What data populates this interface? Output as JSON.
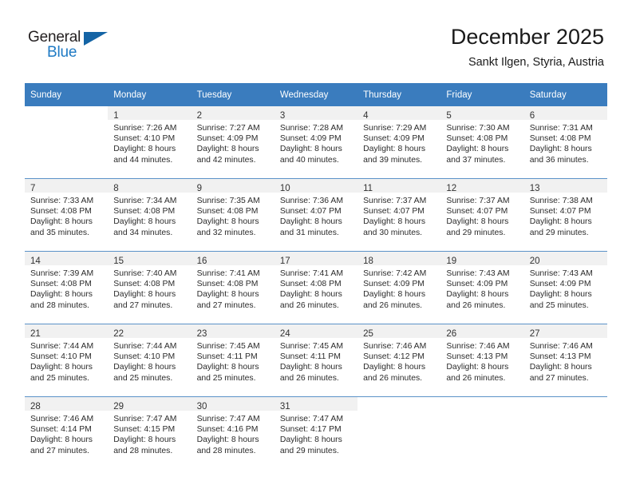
{
  "brand": {
    "name_part1": "General",
    "name_part2": "Blue",
    "triangle_color": "#1464a5",
    "blue_color": "#1e7ac4"
  },
  "header": {
    "title": "December 2025",
    "subtitle": "Sankt Ilgen, Styria, Austria"
  },
  "theme": {
    "header_row_bg": "#3a7cbe",
    "row_divider": "#5b92c8",
    "daynum_band_bg": "#f1f1f1"
  },
  "weekday_headers": [
    "Sunday",
    "Monday",
    "Tuesday",
    "Wednesday",
    "Thursday",
    "Friday",
    "Saturday"
  ],
  "weeks": [
    [
      {
        "day": "",
        "sunrise": "",
        "sunset": "",
        "daylight_line1": "",
        "daylight_line2": ""
      },
      {
        "day": "1",
        "sunrise": "Sunrise: 7:26 AM",
        "sunset": "Sunset: 4:10 PM",
        "daylight_line1": "Daylight: 8 hours",
        "daylight_line2": "and 44 minutes."
      },
      {
        "day": "2",
        "sunrise": "Sunrise: 7:27 AM",
        "sunset": "Sunset: 4:09 PM",
        "daylight_line1": "Daylight: 8 hours",
        "daylight_line2": "and 42 minutes."
      },
      {
        "day": "3",
        "sunrise": "Sunrise: 7:28 AM",
        "sunset": "Sunset: 4:09 PM",
        "daylight_line1": "Daylight: 8 hours",
        "daylight_line2": "and 40 minutes."
      },
      {
        "day": "4",
        "sunrise": "Sunrise: 7:29 AM",
        "sunset": "Sunset: 4:09 PM",
        "daylight_line1": "Daylight: 8 hours",
        "daylight_line2": "and 39 minutes."
      },
      {
        "day": "5",
        "sunrise": "Sunrise: 7:30 AM",
        "sunset": "Sunset: 4:08 PM",
        "daylight_line1": "Daylight: 8 hours",
        "daylight_line2": "and 37 minutes."
      },
      {
        "day": "6",
        "sunrise": "Sunrise: 7:31 AM",
        "sunset": "Sunset: 4:08 PM",
        "daylight_line1": "Daylight: 8 hours",
        "daylight_line2": "and 36 minutes."
      }
    ],
    [
      {
        "day": "7",
        "sunrise": "Sunrise: 7:33 AM",
        "sunset": "Sunset: 4:08 PM",
        "daylight_line1": "Daylight: 8 hours",
        "daylight_line2": "and 35 minutes."
      },
      {
        "day": "8",
        "sunrise": "Sunrise: 7:34 AM",
        "sunset": "Sunset: 4:08 PM",
        "daylight_line1": "Daylight: 8 hours",
        "daylight_line2": "and 34 minutes."
      },
      {
        "day": "9",
        "sunrise": "Sunrise: 7:35 AM",
        "sunset": "Sunset: 4:08 PM",
        "daylight_line1": "Daylight: 8 hours",
        "daylight_line2": "and 32 minutes."
      },
      {
        "day": "10",
        "sunrise": "Sunrise: 7:36 AM",
        "sunset": "Sunset: 4:07 PM",
        "daylight_line1": "Daylight: 8 hours",
        "daylight_line2": "and 31 minutes."
      },
      {
        "day": "11",
        "sunrise": "Sunrise: 7:37 AM",
        "sunset": "Sunset: 4:07 PM",
        "daylight_line1": "Daylight: 8 hours",
        "daylight_line2": "and 30 minutes."
      },
      {
        "day": "12",
        "sunrise": "Sunrise: 7:37 AM",
        "sunset": "Sunset: 4:07 PM",
        "daylight_line1": "Daylight: 8 hours",
        "daylight_line2": "and 29 minutes."
      },
      {
        "day": "13",
        "sunrise": "Sunrise: 7:38 AM",
        "sunset": "Sunset: 4:07 PM",
        "daylight_line1": "Daylight: 8 hours",
        "daylight_line2": "and 29 minutes."
      }
    ],
    [
      {
        "day": "14",
        "sunrise": "Sunrise: 7:39 AM",
        "sunset": "Sunset: 4:08 PM",
        "daylight_line1": "Daylight: 8 hours",
        "daylight_line2": "and 28 minutes."
      },
      {
        "day": "15",
        "sunrise": "Sunrise: 7:40 AM",
        "sunset": "Sunset: 4:08 PM",
        "daylight_line1": "Daylight: 8 hours",
        "daylight_line2": "and 27 minutes."
      },
      {
        "day": "16",
        "sunrise": "Sunrise: 7:41 AM",
        "sunset": "Sunset: 4:08 PM",
        "daylight_line1": "Daylight: 8 hours",
        "daylight_line2": "and 27 minutes."
      },
      {
        "day": "17",
        "sunrise": "Sunrise: 7:41 AM",
        "sunset": "Sunset: 4:08 PM",
        "daylight_line1": "Daylight: 8 hours",
        "daylight_line2": "and 26 minutes."
      },
      {
        "day": "18",
        "sunrise": "Sunrise: 7:42 AM",
        "sunset": "Sunset: 4:09 PM",
        "daylight_line1": "Daylight: 8 hours",
        "daylight_line2": "and 26 minutes."
      },
      {
        "day": "19",
        "sunrise": "Sunrise: 7:43 AM",
        "sunset": "Sunset: 4:09 PM",
        "daylight_line1": "Daylight: 8 hours",
        "daylight_line2": "and 26 minutes."
      },
      {
        "day": "20",
        "sunrise": "Sunrise: 7:43 AM",
        "sunset": "Sunset: 4:09 PM",
        "daylight_line1": "Daylight: 8 hours",
        "daylight_line2": "and 25 minutes."
      }
    ],
    [
      {
        "day": "21",
        "sunrise": "Sunrise: 7:44 AM",
        "sunset": "Sunset: 4:10 PM",
        "daylight_line1": "Daylight: 8 hours",
        "daylight_line2": "and 25 minutes."
      },
      {
        "day": "22",
        "sunrise": "Sunrise: 7:44 AM",
        "sunset": "Sunset: 4:10 PM",
        "daylight_line1": "Daylight: 8 hours",
        "daylight_line2": "and 25 minutes."
      },
      {
        "day": "23",
        "sunrise": "Sunrise: 7:45 AM",
        "sunset": "Sunset: 4:11 PM",
        "daylight_line1": "Daylight: 8 hours",
        "daylight_line2": "and 25 minutes."
      },
      {
        "day": "24",
        "sunrise": "Sunrise: 7:45 AM",
        "sunset": "Sunset: 4:11 PM",
        "daylight_line1": "Daylight: 8 hours",
        "daylight_line2": "and 26 minutes."
      },
      {
        "day": "25",
        "sunrise": "Sunrise: 7:46 AM",
        "sunset": "Sunset: 4:12 PM",
        "daylight_line1": "Daylight: 8 hours",
        "daylight_line2": "and 26 minutes."
      },
      {
        "day": "26",
        "sunrise": "Sunrise: 7:46 AM",
        "sunset": "Sunset: 4:13 PM",
        "daylight_line1": "Daylight: 8 hours",
        "daylight_line2": "and 26 minutes."
      },
      {
        "day": "27",
        "sunrise": "Sunrise: 7:46 AM",
        "sunset": "Sunset: 4:13 PM",
        "daylight_line1": "Daylight: 8 hours",
        "daylight_line2": "and 27 minutes."
      }
    ],
    [
      {
        "day": "28",
        "sunrise": "Sunrise: 7:46 AM",
        "sunset": "Sunset: 4:14 PM",
        "daylight_line1": "Daylight: 8 hours",
        "daylight_line2": "and 27 minutes."
      },
      {
        "day": "29",
        "sunrise": "Sunrise: 7:47 AM",
        "sunset": "Sunset: 4:15 PM",
        "daylight_line1": "Daylight: 8 hours",
        "daylight_line2": "and 28 minutes."
      },
      {
        "day": "30",
        "sunrise": "Sunrise: 7:47 AM",
        "sunset": "Sunset: 4:16 PM",
        "daylight_line1": "Daylight: 8 hours",
        "daylight_line2": "and 28 minutes."
      },
      {
        "day": "31",
        "sunrise": "Sunrise: 7:47 AM",
        "sunset": "Sunset: 4:17 PM",
        "daylight_line1": "Daylight: 8 hours",
        "daylight_line2": "and 29 minutes."
      },
      {
        "day": "",
        "sunrise": "",
        "sunset": "",
        "daylight_line1": "",
        "daylight_line2": ""
      },
      {
        "day": "",
        "sunrise": "",
        "sunset": "",
        "daylight_line1": "",
        "daylight_line2": ""
      },
      {
        "day": "",
        "sunrise": "",
        "sunset": "",
        "daylight_line1": "",
        "daylight_line2": ""
      }
    ]
  ]
}
